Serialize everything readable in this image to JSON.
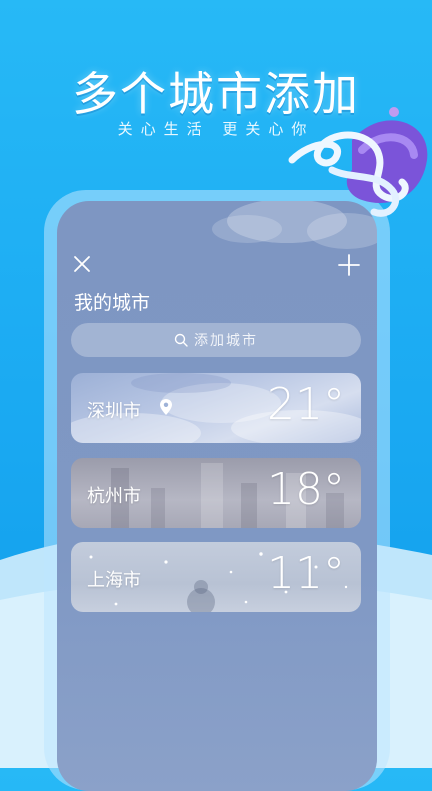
{
  "promo": {
    "headline": "多个城市添加",
    "tagline": "关心生活 更关心你"
  },
  "screen": {
    "close_icon": "close-icon",
    "add_icon": "plus-icon",
    "title": "我的城市",
    "search": {
      "placeholder": "添加城市",
      "icon": "search-icon"
    },
    "cities": [
      {
        "name": "深圳市",
        "temperature": "21°",
        "located": true,
        "icon": "location-pin-icon",
        "weather": "cloudy"
      },
      {
        "name": "杭州市",
        "temperature": "18°",
        "located": false,
        "weather": "overcast"
      },
      {
        "name": "上海市",
        "temperature": "11°",
        "located": false,
        "weather": "snow"
      }
    ]
  },
  "colors": {
    "background": "#1aa9f2",
    "screen": "#7f98c4",
    "text": "#ffffff"
  }
}
